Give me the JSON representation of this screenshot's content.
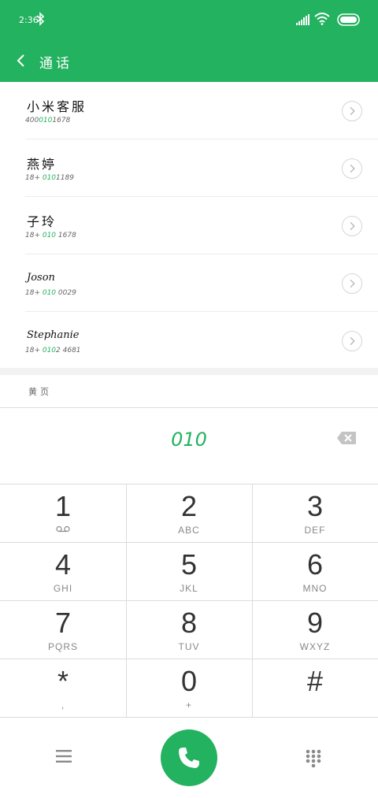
{
  "status_bar": {
    "time": "2:36",
    "icons": [
      "bluetooth-icon",
      "signal-icon",
      "wifi-icon",
      "battery-icon"
    ]
  },
  "app_bar": {
    "title": "通话",
    "back_icon": "chevron-left-icon"
  },
  "contacts": [
    {
      "name": "小米客服",
      "number_prefix": "400",
      "number_match": "010",
      "number_suffix": "1678"
    },
    {
      "name": "燕婷",
      "number_prefix": "18+ ",
      "number_match": "010",
      "number_suffix": "1189"
    },
    {
      "name": "子玲",
      "number_prefix": "18+ ",
      "number_match": "010",
      "number_suffix": " 1678"
    },
    {
      "name": "Joson",
      "number_prefix": "18+ ",
      "number_match": "010",
      "number_suffix": " 0029"
    },
    {
      "name": "Stephanie",
      "number_prefix": "18+ ",
      "number_match": "010",
      "number_suffix": "2 4681"
    }
  ],
  "yellow_pages": "黄页",
  "dial_entry": {
    "digits": "010",
    "backspace_icon": "backspace-icon"
  },
  "keypad": [
    {
      "digit": "1",
      "letters": "voicemail"
    },
    {
      "digit": "2",
      "letters": "ABC"
    },
    {
      "digit": "3",
      "letters": "DEF"
    },
    {
      "digit": "4",
      "letters": "GHI"
    },
    {
      "digit": "5",
      "letters": "JKL"
    },
    {
      "digit": "6",
      "letters": "MNO"
    },
    {
      "digit": "7",
      "letters": "PQRS"
    },
    {
      "digit": "8",
      "letters": "TUV"
    },
    {
      "digit": "9",
      "letters": "WXYZ"
    },
    {
      "digit": "*",
      "letters": ","
    },
    {
      "digit": "0",
      "letters": "+"
    },
    {
      "digit": "#",
      "letters": ""
    }
  ],
  "bottom_bar": {
    "menu_icon": "menu-icon",
    "call_icon": "phone-icon",
    "keypad_icon": "keypad-icon"
  },
  "colors": {
    "accent": "#23b25f"
  }
}
